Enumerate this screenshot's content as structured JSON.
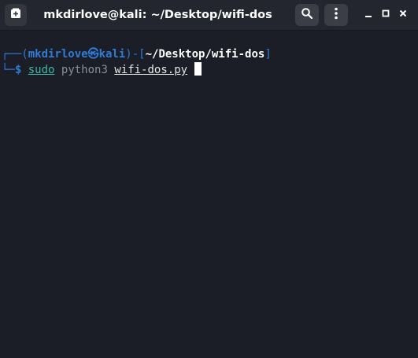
{
  "window": {
    "title": "mkdirlove@kali: ~/Desktop/wifi-dos"
  },
  "icons": {
    "new_tab": "new-tab-icon",
    "search": "search-icon",
    "menu": "kebab-menu-icon",
    "minimize": "minimize-icon",
    "maximize": "maximize-icon",
    "close": "close-icon"
  },
  "terminal": {
    "prompt": {
      "corner_top": "┌──(",
      "user": "mkdirlove",
      "at_symbol": "㉿",
      "host": "kali",
      "mid": ")-[",
      "path": "~/Desktop/wifi-dos",
      "close": "]",
      "corner_bottom": "└─",
      "dollar": "$"
    },
    "command": {
      "sudo": "sudo",
      "program": "python3",
      "argument": "wifi-dos.py"
    }
  },
  "colors": {
    "background": "#1b1e26",
    "titlebar": "#23262e",
    "prompt_blue": "#2f7bd6",
    "command_green": "#3fb6a8"
  }
}
